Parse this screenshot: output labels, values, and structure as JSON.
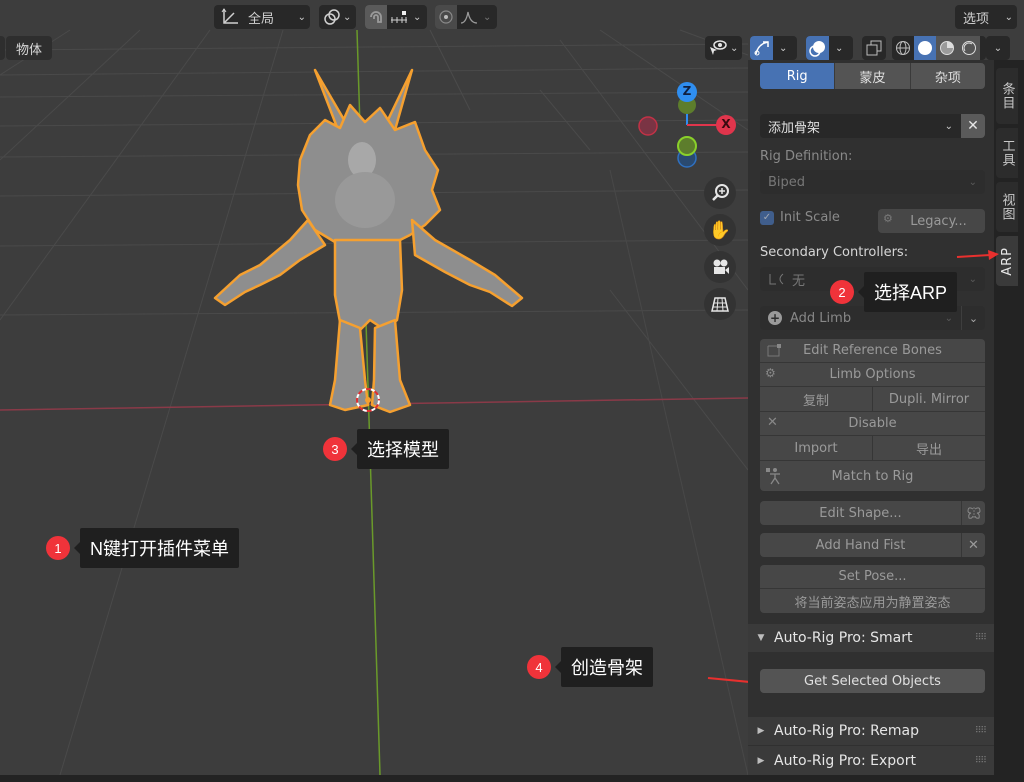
{
  "header": {
    "transform_orientation": "全局",
    "options_label": "选项",
    "mode_tab": "物体"
  },
  "gizmo": {
    "z_label": "Z",
    "x_label": "X",
    "colors": {
      "x": "#e0354c",
      "y": "#86b12f",
      "z": "#2f8ef0"
    }
  },
  "sidebar": {
    "tabs": [
      {
        "label": "条目",
        "active": false
      },
      {
        "label": "工具",
        "active": false
      },
      {
        "label": "视图",
        "active": false
      },
      {
        "label": "ARP",
        "active": true
      }
    ],
    "top_segments": [
      {
        "label": "Rig",
        "active": true
      },
      {
        "label": "蒙皮",
        "active": false
      },
      {
        "label": "杂项",
        "active": false
      }
    ],
    "add_armature": "添加骨架",
    "rig_definition_label": "Rig Definition:",
    "rig_definition_value": "Biped",
    "init_scale_label": "Init Scale",
    "init_scale_checked": true,
    "legacy_button": "Legacy...",
    "secondary_controllers_label": "Secondary Controllers:",
    "secondary_controllers_value": "无",
    "add_limb": "Add Limb",
    "edit_reference_bones": "Edit Reference Bones",
    "limb_options": "Limb Options",
    "duplicate": "复制",
    "dupli_mirror": "Dupli. Mirror",
    "disable": "Disable",
    "import": "Import",
    "export": "导出",
    "match_to_rig": "Match to Rig",
    "edit_shape": "Edit Shape...",
    "add_hand_fist": "Add Hand Fist",
    "set_pose": "Set Pose...",
    "apply_rest_pose": "将当前姿态应用为静置姿态",
    "panels": {
      "smart": "Auto-Rig Pro: Smart",
      "get_selected_objects": "Get Selected Objects",
      "remap": "Auto-Rig Pro: Remap",
      "export": "Auto-Rig Pro: Export"
    }
  },
  "annotations": [
    {
      "number": "1",
      "text": "N键打开插件菜单"
    },
    {
      "number": "2",
      "text": "选择ARP"
    },
    {
      "number": "3",
      "text": "选择模型"
    },
    {
      "number": "4",
      "text": "创造骨架"
    }
  ],
  "accent": {
    "selection_outline": "#f5a030",
    "annotation": "#f0333a",
    "active_blue": "#4772b3"
  }
}
